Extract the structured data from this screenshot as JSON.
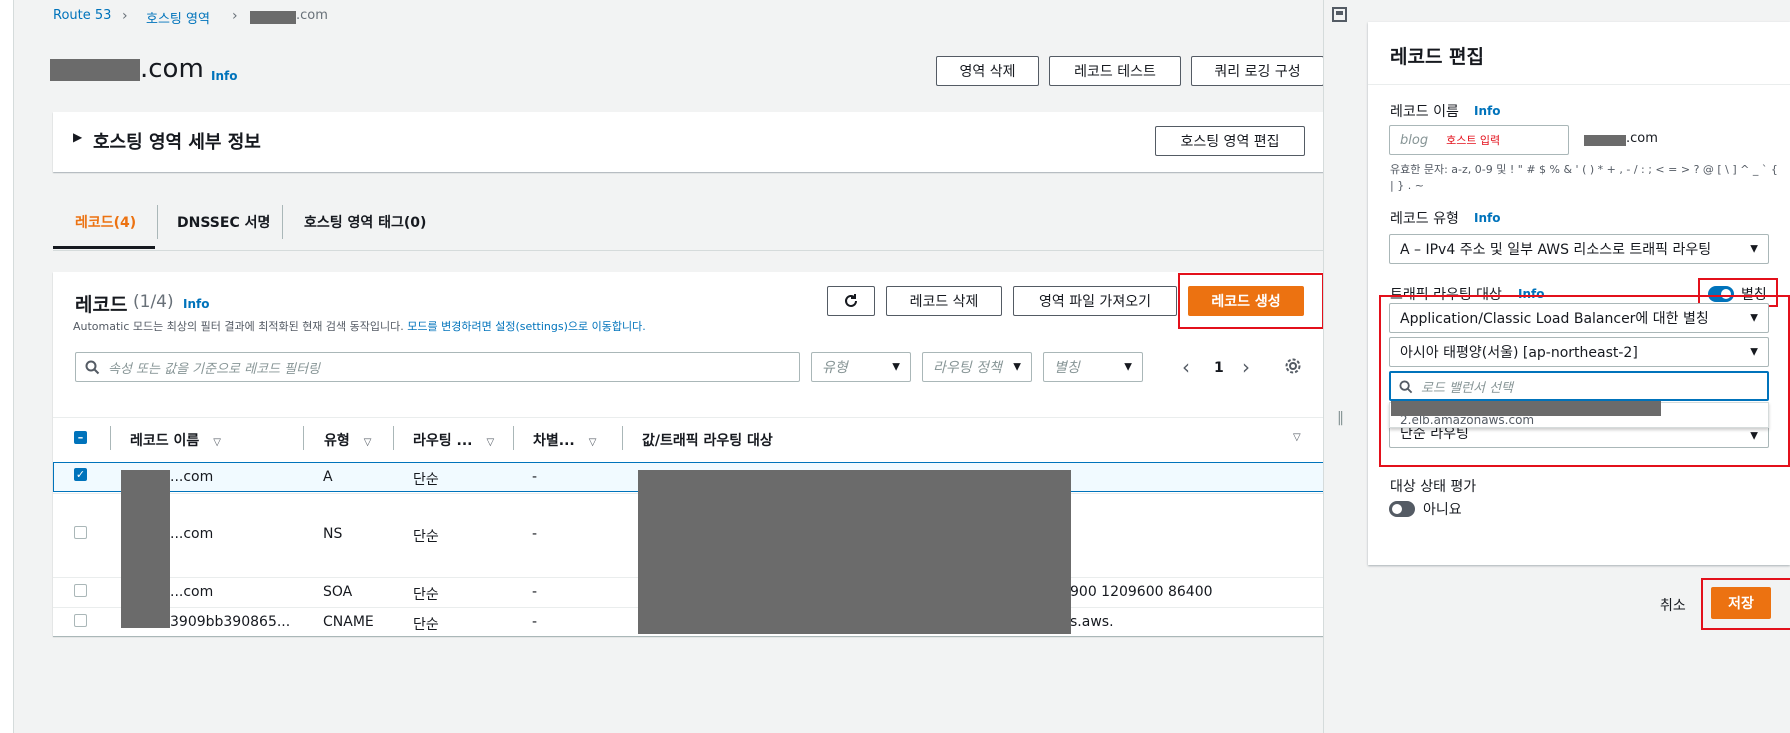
{
  "breadcrumb": {
    "route53": "Route 53",
    "hosted_zones": "호스팅 영역",
    "domain_suffix": ".com"
  },
  "header": {
    "title_suffix": ".com",
    "info": "Info",
    "delete_zone": "영역 삭제",
    "test_record": "레코드 테스트",
    "query_logging": "쿼리 로깅 구성"
  },
  "details": {
    "title": "호스팅 영역 세부 정보",
    "edit_button": "호스팅 영역 편집"
  },
  "tabs": [
    {
      "label": "레코드(4)",
      "active": true
    },
    {
      "label": "DNSSEC 서명",
      "active": false
    },
    {
      "label": "호스팅 영역 태그(0)",
      "active": false
    }
  ],
  "records": {
    "title": "레코드",
    "count": "(1/4)",
    "info": "Info",
    "desc_text": "Automatic 모드는 최상의 필터 결과에 최적화된 현재 검색 동작입니다.",
    "desc_link": "모드를 변경하려면 설정(settings)으로 이동합니다.",
    "delete_button": "레코드 삭제",
    "import_button": "영역 파일 가져오기",
    "create_button": "레코드 생성",
    "search_placeholder": "속성 또는 값을 기준으로 레코드 필터링",
    "filter_type": "유형",
    "filter_policy": "라우팅 정책",
    "filter_alias": "별칭",
    "page": "1",
    "columns": [
      "레코드 이름",
      "유형",
      "라우팅 ...",
      "차별...",
      "값/트래픽 라우팅 대상"
    ],
    "rows": [
      {
        "name": "...com",
        "type": "A",
        "policy": "단순",
        "diff": "-",
        "value": "",
        "checked": true
      },
      {
        "name": "...com",
        "type": "NS",
        "policy": "단순",
        "diff": "-",
        "value": "",
        "checked": false
      },
      {
        "name": "...com",
        "type": "SOA",
        "policy": "단순",
        "diff": "-",
        "value": "900 1209600 86400",
        "checked": false
      },
      {
        "name": "3909bb390865...",
        "type": "CNAME",
        "policy": "단순",
        "diff": "-",
        "value": "s.aws.",
        "checked": false
      }
    ]
  },
  "edit_panel": {
    "title": "레코드 편집",
    "record_name_label": "레코드 이름",
    "info": "Info",
    "name_placeholder": "blog",
    "host_annotation": "호스트 입력",
    "domain_suffix": ".com",
    "valid_chars": "유효한 문자: a-z, 0-9 및 ! \" # $ % & ' ( ) * + , - / : ; < = > ? @ [ \\ ] ^ _ ` { | } . ~",
    "record_type_label": "레코드 유형",
    "record_type_value": "A – IPv4 주소 및 일부 AWS 리소스로 트래픽 라우팅",
    "routing_target_label": "트래픽 라우팅 대상",
    "alias_label": "별칭",
    "alias_type": "Application/Classic Load Balancer에 대한 별칭",
    "region": "아시아 태평양(서울) [ap-northeast-2]",
    "lb_search_placeholder": "로드 밸런서 선택",
    "lb_option": "2.elb.amazonaws.com",
    "routing_policy": "단순 라우팅",
    "health_label": "대상 상태 평가",
    "health_value": "아니요",
    "cancel": "취소",
    "save": "저장"
  },
  "colors": {
    "accent": "#ec7211",
    "link": "#0073bb",
    "highlight": "#e3101b"
  }
}
